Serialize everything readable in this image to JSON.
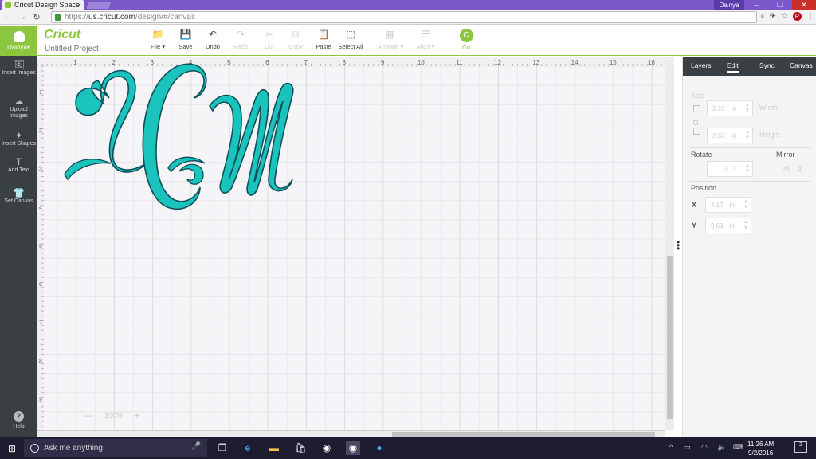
{
  "browser": {
    "tab_title": "Cricut Design Space",
    "tab_close": "×",
    "user_name": "Dainya",
    "url_prefix": "https://",
    "url_host": "us.cricut.com",
    "url_path": "/design/#/canvas",
    "controls": {
      "minimize": "–",
      "restore": "❐",
      "close": "✕"
    },
    "nav": {
      "back": "←",
      "forward": "→",
      "reload": "↻"
    }
  },
  "app": {
    "user_label": "Dainya▾",
    "logo": "Cricut",
    "project_name": "Untitled Project",
    "toolbar": [
      {
        "key": "file",
        "label": "File ▾",
        "icon": "folder-icon",
        "glyph": "📁",
        "enabled": true
      },
      {
        "key": "save",
        "label": "Save",
        "icon": "save-icon",
        "glyph": "💾",
        "enabled": true
      },
      {
        "key": "undo",
        "label": "Undo",
        "icon": "undo-icon",
        "glyph": "↶",
        "enabled": true
      },
      {
        "key": "redo",
        "label": "Redo",
        "icon": "redo-icon",
        "glyph": "↷",
        "enabled": false
      },
      {
        "key": "cut",
        "label": "Cut",
        "icon": "cut-icon",
        "glyph": "✂",
        "enabled": false
      },
      {
        "key": "copy",
        "label": "Copy",
        "icon": "copy-icon",
        "glyph": "⧉",
        "enabled": false
      },
      {
        "key": "paste",
        "label": "Paste",
        "icon": "paste-icon",
        "glyph": "📋",
        "enabled": true
      },
      {
        "key": "select_all",
        "label": "Select All",
        "icon": "select-all-icon",
        "glyph": "⬚",
        "enabled": true
      },
      {
        "key": "arrange",
        "label": "Arrange ▾",
        "icon": "arrange-icon",
        "glyph": "▦",
        "enabled": false
      },
      {
        "key": "align",
        "label": "Align ▾",
        "icon": "align-icon",
        "glyph": "☰",
        "enabled": false
      }
    ],
    "go": {
      "label": "Go",
      "glyph": "C"
    }
  },
  "sidebar": {
    "items": [
      {
        "key": "insert_images",
        "label": "Insert Images",
        "icon": "image-icon",
        "glyph": "🖼"
      },
      {
        "key": "upload_images",
        "label": "Upload Images",
        "icon": "cloud-upload-icon",
        "glyph": "☁"
      },
      {
        "key": "insert_shapes",
        "label": "Insert Shapes",
        "icon": "shapes-icon",
        "glyph": "✦"
      },
      {
        "key": "add_text",
        "label": "Add Text",
        "icon": "text-icon",
        "glyph": "T"
      },
      {
        "key": "set_canvas",
        "label": "Set Canvas",
        "icon": "shirt-icon",
        "glyph": "👕"
      }
    ],
    "help": {
      "label": "Help",
      "glyph": "?"
    }
  },
  "canvas": {
    "ruler_x": [
      "1",
      "2",
      "3",
      "4",
      "5",
      "6",
      "7",
      "8",
      "9",
      "10",
      "11",
      "12",
      "13",
      "14",
      "15",
      "16"
    ],
    "ruler_y": [
      "1",
      "2",
      "3",
      "4",
      "5",
      "6",
      "7",
      "8",
      "9"
    ],
    "monogram": "LCM",
    "monogram_colors": {
      "fill": "#1bc3bd",
      "stroke": "#0f4f59"
    },
    "zoom": {
      "level": "100%",
      "minus": "—",
      "plus": "+"
    }
  },
  "panel": {
    "tabs": [
      "Layers",
      "Edit",
      "Sync",
      "Canvas"
    ],
    "active_tab": "Edit",
    "size_label": "Size",
    "width_value": "2.15",
    "width_label": "Width",
    "height_value": "2.83",
    "height_label": "Height",
    "unit": "in",
    "rotate_label": "Rotate",
    "rotate_value": "0",
    "rotate_unit": "°",
    "mirror_label": "Mirror",
    "position_label": "Position",
    "x_label": "X",
    "x_value": "4.17",
    "y_label": "Y",
    "y_value": "0.63"
  },
  "taskbar": {
    "search_placeholder": "Ask me anything",
    "time": "11:26 AM",
    "date": "9/2/2016",
    "notifications": "2"
  },
  "colors": {
    "brand_green": "#8cc63f",
    "sidebar_dark": "#3a3f44",
    "chrome_purple": "#7b58c9",
    "taskbar": "#1e1c30"
  }
}
